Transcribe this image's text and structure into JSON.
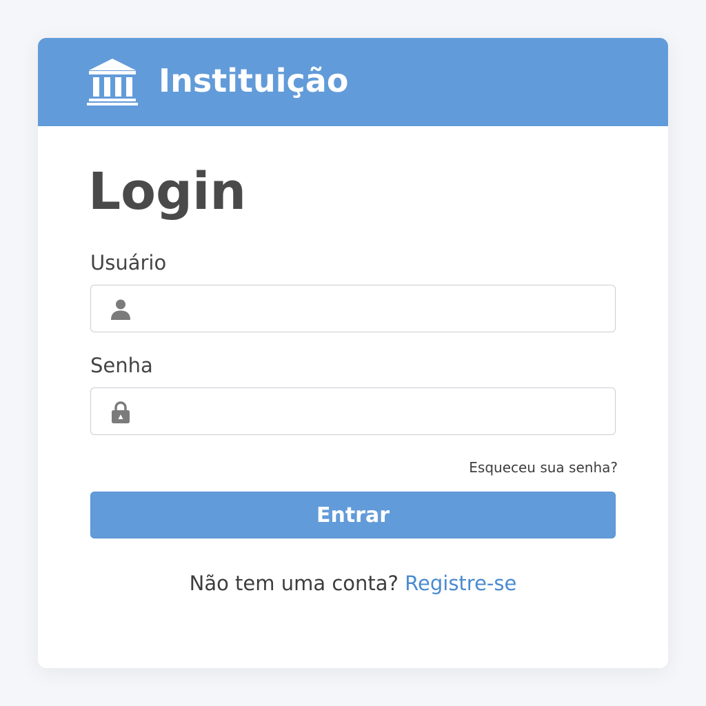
{
  "header": {
    "institution_name": "Instituição",
    "logo_icon": "institution-building-icon"
  },
  "login": {
    "title": "Login",
    "username": {
      "label": "Usuário",
      "value": "",
      "placeholder": "",
      "icon": "user-icon"
    },
    "password": {
      "label": "Senha",
      "value": "",
      "placeholder": "",
      "icon": "lock-icon"
    },
    "forgot_password_label": "Esqueceu sua senha?",
    "submit_label": "Entrar",
    "signup_prompt": "Não tem uma conta?",
    "signup_link_label": "Registre-se"
  },
  "colors": {
    "accent": "#629bd9",
    "link": "#4a8bd0",
    "title_text": "#4a4a4a",
    "icon_gray": "#7b7b7b",
    "page_background": "#f5f6f9"
  }
}
